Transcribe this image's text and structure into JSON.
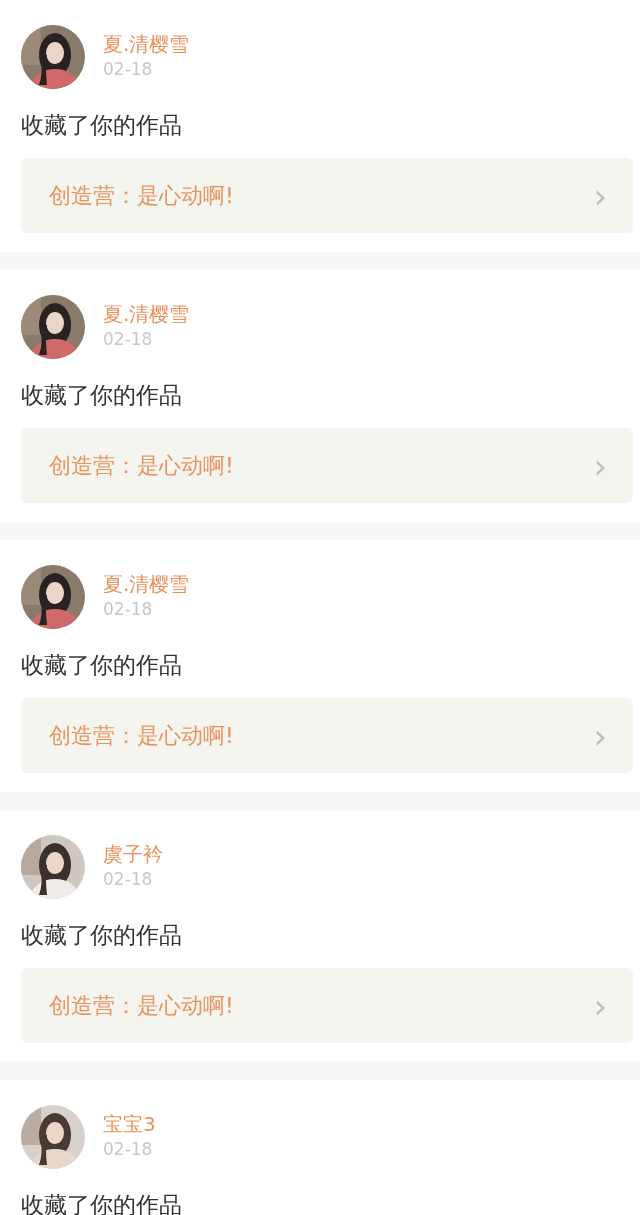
{
  "notifications": [
    {
      "user": "夏.清樱雪",
      "date": "02-18",
      "action": "收藏了你的作品",
      "work": {
        "title": "创造营：是心动啊!",
        "chevron": "›"
      }
    },
    {
      "user": "夏.清樱雪",
      "date": "02-18",
      "action": "收藏了你的作品",
      "work": {
        "title": "创造营：是心动啊!",
        "chevron": "›"
      }
    },
    {
      "user": "夏.清樱雪",
      "date": "02-18",
      "action": "收藏了你的作品",
      "work": {
        "title": "创造营：是心动啊!",
        "chevron": "›"
      }
    },
    {
      "user": "虞子衿",
      "date": "02-18",
      "action": "收藏了你的作品",
      "work": {
        "title": "创造营：是心动啊!",
        "chevron": "›"
      }
    },
    {
      "user": "宝宝3",
      "date": "02-18",
      "action": "收藏了你的作品"
    }
  ]
}
